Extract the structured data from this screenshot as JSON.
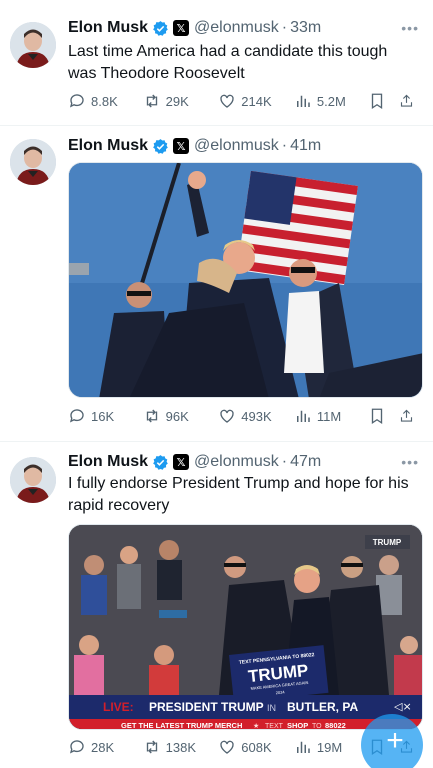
{
  "tweets": [
    {
      "name": "Elon Musk",
      "handle": "@elonmusk",
      "separator": "·",
      "time": "33m",
      "text": "Last time America had a candidate this tough was Theodore Roosevelt",
      "stats": {
        "replies": "8.8K",
        "reposts": "29K",
        "likes": "214K",
        "views": "5.2M"
      }
    },
    {
      "name": "Elon Musk",
      "handle": "@elonmusk",
      "separator": "·",
      "time": "41m",
      "text": "",
      "stats": {
        "replies": "16K",
        "reposts": "96K",
        "likes": "493K",
        "views": "11M"
      }
    },
    {
      "name": "Elon Musk",
      "handle": "@elonmusk",
      "separator": "·",
      "time": "47m",
      "text": "I fully endorse President Trump and hope for his rapid recovery",
      "stats": {
        "replies": "28K",
        "reposts": "138K",
        "likes": "608K",
        "views": "19M"
      },
      "media_overlay": {
        "corner_logo": "TRUMP",
        "sign_top": "TEXT PENNSYLVANIA TO 88022",
        "sign_main": "TRUMP",
        "sign_sub": "MAKE AMERICA GREAT AGAIN",
        "sign_year": "2024",
        "live_label": "LIVE:",
        "headline_a": "PRESIDENT TRUMP",
        "headline_in": "IN",
        "headline_b": "BUTLER, PA",
        "ticker_a": "GET THE LATEST TRUMP MERCH",
        "ticker_star": "★",
        "ticker_b": "TEXT",
        "ticker_c": "SHOP",
        "ticker_d": "TO",
        "ticker_e": "88022"
      }
    }
  ],
  "icons": [
    "more-icon",
    "verified-icon",
    "x-badge-icon",
    "reply-icon",
    "repost-icon",
    "like-icon",
    "views-icon",
    "bookmark-icon",
    "share-icon",
    "compose-icon"
  ],
  "compose": {
    "symbol": "+"
  },
  "colors": {
    "accent": "#1d9bf0",
    "secondary_text": "#536471",
    "live_red": "#d21f2b",
    "banner_navy": "#1c2a6b"
  }
}
